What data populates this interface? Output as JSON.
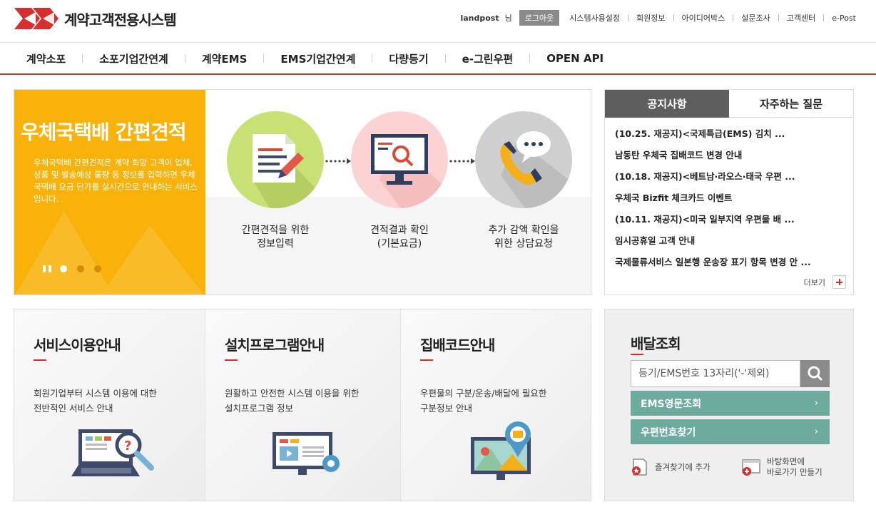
{
  "header": {
    "logo_text": "계약고객전용시스템",
    "user_id": "landpost",
    "user_suffix": "님",
    "logout": "로그아웃",
    "links": [
      "시스템사용설정",
      "회원정보",
      "아이디어박스",
      "설문조사",
      "고객센터",
      "e-Post"
    ]
  },
  "gnb": [
    "계약소포",
    "소포기업간연계",
    "계약EMS",
    "EMS기업간연계",
    "다량등기",
    "e-그린우편",
    "OPEN API"
  ],
  "banner": {
    "title": "우체국택배 간편견적",
    "description": "우체국택배 간편견적은 계약 희망 고객이 업체, 상품 및 발송예상 물량 등 정보를 입력하면 우체국택배 요금 단가를 실시간으로 안내하는 서비스입니다.",
    "steps": [
      {
        "line1": "간편견적을 위한",
        "line2": "정보입력",
        "color": "#c9e075"
      },
      {
        "line1": "견적결과 확인",
        "line2": "(기본요금)",
        "color": "#fcd2d2"
      },
      {
        "line1": "추가 감액 확인을",
        "line2": "위한 상담요청",
        "color": "#cfcfcf"
      }
    ],
    "slide_count": 3,
    "active_slide": 1
  },
  "notice": {
    "tabs": [
      "공지사항",
      "자주하는 질문"
    ],
    "active_tab": 0,
    "items": [
      "(10.25. 재공지)<국제특급(EMS) 김치  ...",
      "남동탄 우체국 집배코드 변경 안내",
      "(10.18. 재공지)<베트남·라오스·태국 우편 ...",
      "우체국 Bizfit 체크카드 이벤트",
      "(10.11. 재공지)<미국 일부지역 우편물 배 ...",
      "임시공휴일 고객 안내",
      "국제물류서비스 일본행 운송장 표기 항목 변경 안 ..."
    ],
    "more": "더보기"
  },
  "cards": [
    {
      "title": "서비스이용안내",
      "line1": "회원기업부터 시스템 이용에 대한",
      "line2": "전반적인 서비스 안내"
    },
    {
      "title": "설치프로그램안내",
      "line1": "원활하고 안전한 시스템 이용을 위한",
      "line2": "설치프로그램 정보"
    },
    {
      "title": "집배코드안내",
      "line1": "우편물의 구분/운송/배달에 필요한",
      "line2": "구분정보 안내"
    }
  ],
  "tracking": {
    "title": "배달조회",
    "placeholder": "등기/EMS번호 13자리('-'제외)",
    "btn_ems": "EMS영문조회",
    "btn_zip": "우편번호찾기",
    "chevron": "›",
    "bookmark": "즐겨찾기에 추가",
    "shortcut_line1": "바탕화면에",
    "shortcut_line2": "바로가기 만들기"
  },
  "colors": {
    "brand_red": "#d72e2e",
    "banner_yellow": "#f9b20a",
    "tab_active": "#5e5e5e",
    "button_green": "#6cab9e"
  }
}
